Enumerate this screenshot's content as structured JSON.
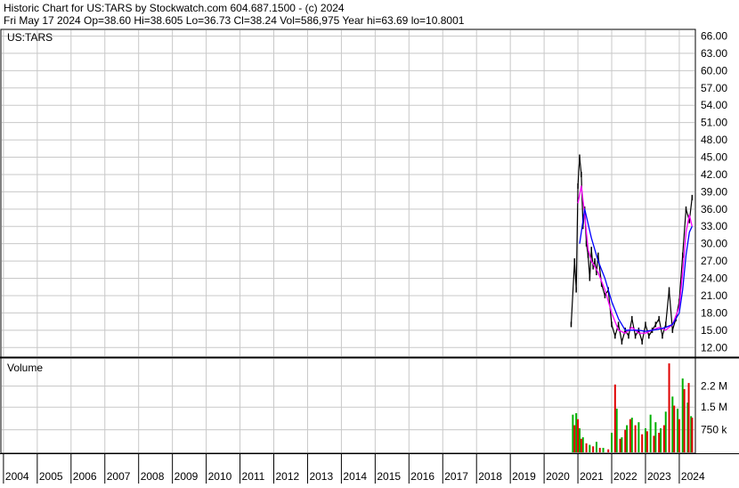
{
  "header": {
    "line1": "Historic Chart for US:TARS by Stockwatch.com 604.687.1500 - (c) 2024",
    "line2": "Fri May 17 2024   Op=38.60   Hi=38.605   Lo=36.73   Cl=38.24   Vol=586,975   Year hi=63.69   lo=10.8001"
  },
  "colors": {
    "grid": "#c8c8c8",
    "price": "#000000",
    "ma_fast": "#ff00ff",
    "ma_slow": "#0000ff",
    "vol_up": "#00b000",
    "vol_down": "#e00000"
  },
  "chart_data": [
    {
      "type": "line",
      "title": "US:TARS",
      "ylim": [
        10.5,
        67
      ],
      "y_ticks": [
        "12.00",
        "15.00",
        "18.00",
        "21.00",
        "24.00",
        "27.00",
        "30.00",
        "33.00",
        "36.00",
        "39.00",
        "42.00",
        "45.00",
        "48.00",
        "51.00",
        "54.00",
        "57.00",
        "60.00",
        "63.00",
        "66.00"
      ],
      "x_ticks": [
        "2004",
        "2005",
        "2006",
        "2007",
        "2008",
        "2009",
        "2010",
        "2011",
        "2012",
        "2013",
        "2014",
        "2015",
        "2016",
        "2017",
        "2018",
        "2019",
        "2020",
        "2021",
        "2022",
        "2023",
        "2024"
      ],
      "grid": true,
      "series": [
        {
          "role": "price",
          "x": [
            2020.8,
            2020.9,
            2020.95,
            2021.0,
            2021.05,
            2021.1,
            2021.15,
            2021.2,
            2021.25,
            2021.3,
            2021.35,
            2021.4,
            2021.45,
            2021.5,
            2021.55,
            2021.6,
            2021.7,
            2021.8,
            2021.9,
            2022.0,
            2022.1,
            2022.2,
            2022.3,
            2022.4,
            2022.5,
            2022.6,
            2022.7,
            2022.8,
            2022.9,
            2023.0,
            2023.1,
            2023.2,
            2023.3,
            2023.4,
            2023.5,
            2023.6,
            2023.7,
            2023.8,
            2023.9,
            2024.0,
            2024.1,
            2024.2,
            2024.3,
            2024.38
          ],
          "values": [
            16,
            27,
            22,
            40,
            45,
            42,
            33,
            36,
            30,
            28,
            24,
            29,
            26,
            27,
            25,
            28,
            23,
            21,
            22,
            16,
            14,
            16,
            13,
            15,
            14,
            17,
            14,
            15,
            13,
            16,
            14,
            15,
            16,
            17,
            14,
            16,
            22,
            15,
            17,
            20,
            28,
            36,
            34,
            38
          ]
        },
        {
          "role": "moving-average-fast",
          "x": [
            2021.0,
            2021.1,
            2021.2,
            2021.3,
            2021.4,
            2021.5,
            2021.6,
            2021.8,
            2022.0,
            2022.2,
            2022.4,
            2022.6,
            2022.8,
            2023.0,
            2023.2,
            2023.4,
            2023.6,
            2023.8,
            2024.0,
            2024.1,
            2024.2,
            2024.3,
            2024.38
          ],
          "values": [
            37,
            40,
            35,
            29,
            27,
            26,
            25,
            22,
            18,
            15,
            14.5,
            15.5,
            14.5,
            14.5,
            15,
            15.5,
            15,
            16,
            19,
            25,
            32,
            35,
            33
          ]
        },
        {
          "role": "moving-average-slow",
          "x": [
            2021.05,
            2021.2,
            2021.4,
            2021.6,
            2021.8,
            2022.0,
            2022.2,
            2022.4,
            2022.6,
            2022.8,
            2023.0,
            2023.2,
            2023.4,
            2023.6,
            2023.8,
            2024.0,
            2024.1,
            2024.2,
            2024.3,
            2024.38
          ],
          "values": [
            30,
            36,
            31,
            27,
            24,
            20,
            17,
            15,
            15,
            15,
            14.8,
            15,
            15.2,
            15.5,
            16,
            18,
            22,
            28,
            32,
            33
          ]
        }
      ]
    },
    {
      "type": "bar",
      "title": "Volume",
      "ylim": [
        0,
        3100000
      ],
      "y_ticks": [
        "750 k",
        "1.5 M",
        "2.2 M"
      ],
      "series": [
        {
          "name": "up",
          "x": [
            2020.85,
            2020.95,
            2021.05,
            2021.15,
            2021.35,
            2021.55,
            2021.75,
            2022.0,
            2022.15,
            2022.3,
            2022.45,
            2022.6,
            2022.8,
            2023.0,
            2023.15,
            2023.3,
            2023.45,
            2023.6,
            2023.8,
            2023.95,
            2024.1,
            2024.25,
            2024.35
          ],
          "values": [
            1250000,
            1300000,
            800000,
            500000,
            250000,
            350000,
            150000,
            650000,
            1450000,
            500000,
            900000,
            1150000,
            1000000,
            800000,
            1250000,
            1000000,
            800000,
            1350000,
            1850000,
            1450000,
            2450000,
            1650000,
            1200000
          ]
        },
        {
          "name": "down",
          "x": [
            2020.9,
            2021.0,
            2021.1,
            2021.25,
            2021.45,
            2021.65,
            2021.9,
            2022.1,
            2022.25,
            2022.4,
            2022.55,
            2022.7,
            2022.9,
            2023.05,
            2023.25,
            2023.4,
            2023.55,
            2023.7,
            2023.85,
            2024.0,
            2024.15,
            2024.28,
            2024.38
          ],
          "values": [
            900000,
            1100000,
            450000,
            300000,
            200000,
            150000,
            100000,
            2250000,
            450000,
            750000,
            1100000,
            900000,
            600000,
            700000,
            550000,
            650000,
            900000,
            2950000,
            1550000,
            1100000,
            2100000,
            2300000,
            1150000
          ]
        }
      ]
    }
  ]
}
